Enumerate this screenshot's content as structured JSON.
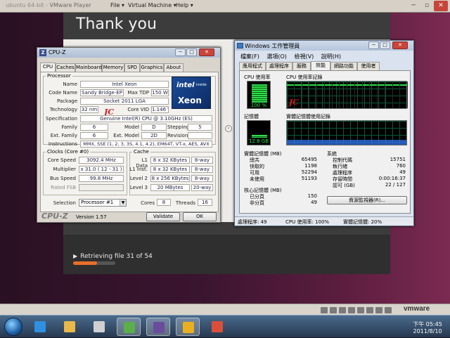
{
  "vm": {
    "title": "ubuntu 64-bit",
    "player": "VMware Player",
    "menu": [
      "File ▾",
      "Virtual Machine ▾",
      "Help ▾"
    ],
    "brand": "vmware"
  },
  "installer": {
    "title": "Thank you",
    "status": "Retrieving file 31 of 54",
    "progress": 0.57
  },
  "cpuz": {
    "title": "CPU-Z",
    "tabs": [
      "CPU",
      "Caches",
      "Mainboard",
      "Memory",
      "SPD",
      "Graphics",
      "About"
    ],
    "active_tab": "CPU",
    "processor": {
      "group": "Processor",
      "name_label": "Name",
      "name": "Intel Xeon",
      "codename_label": "Code Name",
      "codename": "Sandy Bridge-EP",
      "maxtdp_label": "Max TDP",
      "maxtdp": "150 W",
      "package_label": "Package",
      "package": "Socket 2011 LGA",
      "technology_label": "Technology",
      "technology": "32 nm",
      "corevid_label": "Core VID",
      "corevid": "1.146 V",
      "spec_label": "Specification",
      "spec": "Genuine Intel(R) CPU @ 3.10GHz (ES)",
      "family_label": "Family",
      "family": "6",
      "model_label": "Model",
      "model": "D",
      "stepping_label": "Stepping",
      "stepping": "5",
      "extfamily_label": "Ext. Family",
      "extfamily": "6",
      "extmodel_label": "Ext. Model",
      "extmodel": "2D",
      "revision_label": "Revision",
      "revision": "",
      "instructions_label": "Instructions",
      "instructions": "MMX, SSE (1, 2, 3, 3S, 4.1, 4.2), EM64T, VT-x, AES, AVX"
    },
    "logo": {
      "brand": "intel",
      "inside": "inside",
      "product": "Xeon"
    },
    "watermark": "JC",
    "clocks": {
      "group": "Clocks (Core #0)",
      "core_speed_label": "Core Speed",
      "core_speed": "3092.4 MHz",
      "multiplier_label": "Multiplier",
      "multiplier": "x 31.0 ( 12 - 31 )",
      "bus_speed_label": "Bus Speed",
      "bus_speed": "99.8 MHz",
      "rated_fsb_label": "Rated FSB",
      "rated_fsb": ""
    },
    "cache": {
      "group": "Cache",
      "l1d_label": "L1 Data",
      "l1d": "8 x 32 KBytes",
      "l1d_way": "8-way",
      "l1i_label": "L1 Inst.",
      "l1i": "8 x 32 KBytes",
      "l1i_way": "8-way",
      "l2_label": "Level 2",
      "l2": "8 x 256 KBytes",
      "l2_way": "8-way",
      "l3_label": "Level 3",
      "l3": "20 MBytes",
      "l3_way": "20-way"
    },
    "selection_label": "Selection",
    "selection": "Processor #1",
    "cores_label": "Cores",
    "cores": "8",
    "threads_label": "Threads",
    "threads": "16",
    "brand_text": "CPU-Z",
    "version": "Version 1.57",
    "validate": "Validate",
    "ok": "OK"
  },
  "taskmgr": {
    "title": "Windows 工作管理員",
    "menu": [
      "檔案(F)",
      "選項(O)",
      "檢視(V)",
      "說明(H)"
    ],
    "tabs": [
      "應用程式",
      "處理程序",
      "服務",
      "效能",
      "網路功能",
      "使用者"
    ],
    "active_tab": "效能",
    "cpu_usage_label": "CPU 使用率",
    "cpu_usage_value": "100 %",
    "cpu_usage_fraction": 1.0,
    "cpu_history_label": "CPU 使用率記錄",
    "memory_label": "記憶體",
    "memory_value": "12.8 GB",
    "memory_fraction": 0.2,
    "memory_history_label": "實體記憶體使用記錄",
    "physical": {
      "header": "實體記憶體 (MB)",
      "rows": [
        {
          "label": "總共",
          "value": "65495"
        },
        {
          "label": "快取的",
          "value": "1198"
        },
        {
          "label": "可用",
          "value": "52294"
        },
        {
          "label": "未使用",
          "value": "51193"
        }
      ]
    },
    "system": {
      "header": "系統",
      "rows": [
        {
          "label": "控制代碼",
          "value": "15751"
        },
        {
          "label": "執行緒",
          "value": "760"
        },
        {
          "label": "處理程序",
          "value": "49"
        },
        {
          "label": "存留時間",
          "value": "0:00:16:37"
        },
        {
          "label": "認可 (GB)",
          "value": "22 / 127"
        }
      ]
    },
    "kernel": {
      "header": "核心記憶體 (MB)",
      "rows": [
        {
          "label": "已分頁",
          "value": "150"
        },
        {
          "label": "非分頁",
          "value": "49"
        }
      ]
    },
    "resource_monitor": "資源監視器(R)...",
    "status": {
      "processes": "處理程序: 49",
      "cpu": "CPU 使用率: 100%",
      "memory": "實體記憶體: 20%"
    }
  },
  "taskbar": {
    "apps": [
      "internet-explorer-icon",
      "explorer-folder-icon",
      "media-player-icon",
      "task-manager-icon",
      "cpuz-icon",
      "vmware-icon",
      "paint-icon"
    ],
    "clock_time": "下午 05:45",
    "clock_date": "2011/8/10"
  }
}
